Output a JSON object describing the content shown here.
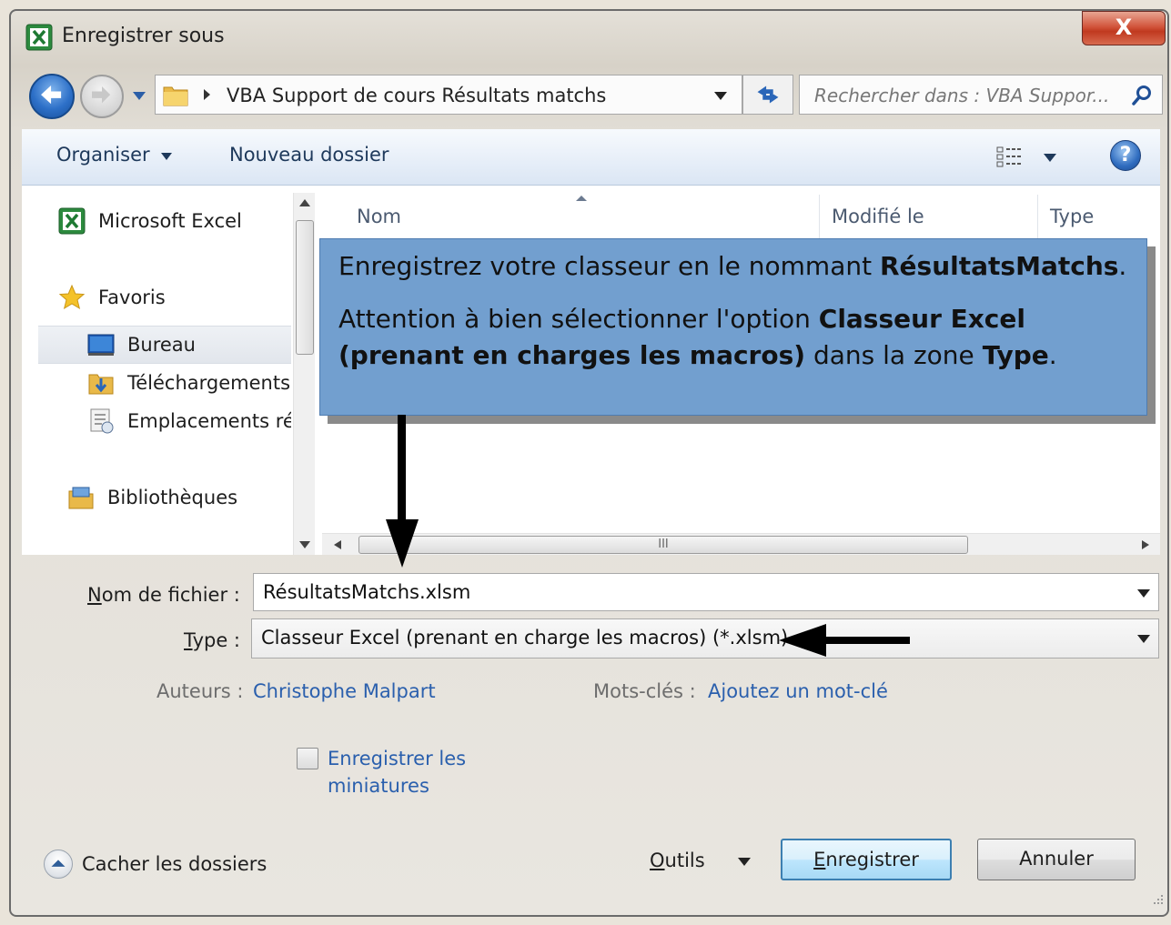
{
  "window": {
    "title": "Enregistrer sous",
    "close_label": "X"
  },
  "nav": {
    "address": "VBA Support de cours Résultats matchs",
    "search_placeholder": "Rechercher dans : VBA Suppor..."
  },
  "toolbar": {
    "organise_label": "Organiser",
    "new_folder_label": "Nouveau dossier",
    "help_label": "?"
  },
  "sidebar": {
    "items": [
      {
        "label": "Microsoft Excel",
        "icon": "excel-icon"
      },
      {
        "label": "Favoris",
        "icon": "star-icon"
      },
      {
        "label": "Bureau",
        "icon": "desktop-icon"
      },
      {
        "label": "Téléchargements",
        "icon": "downloads-icon"
      },
      {
        "label": "Emplacements récents",
        "icon": "recent-places-icon"
      },
      {
        "label": "Bibliothèques",
        "icon": "libraries-icon"
      }
    ]
  },
  "file_list": {
    "columns": [
      "Nom",
      "Modifié le",
      "Type"
    ],
    "hscroll_grip": "III"
  },
  "callout": {
    "line1_prefix": "Enregistrez votre classeur en le nommant ",
    "line1_bold": "RésultatsMatchs",
    "line1_suffix": ".",
    "line2_prefix": "Attention à bien sélectionner l'option ",
    "line2_bold": "Classeur Excel (prenant en charges les macros)",
    "line2_middle": " dans la zone ",
    "line2_bold2": "Type",
    "line2_suffix": "."
  },
  "form": {
    "filename_label": "Nom de fichier :",
    "filename_value": "RésultatsMatchs.xlsm",
    "type_label": "Type :",
    "type_value": "Classeur Excel (prenant en charge les macros) (*.xlsm)",
    "authors_label": "Auteurs :",
    "authors_value": "Christophe Malpart",
    "keywords_label": "Mots-clés :",
    "keywords_value": "Ajoutez un mot-clé",
    "thumbnails_line1": "Enregistrer les",
    "thumbnails_line2": "miniatures"
  },
  "footer": {
    "hide_folders_label": "Cacher les dossiers",
    "tools_label": "Outils",
    "save_label": "Enregistrer",
    "cancel_label": "Annuler"
  }
}
